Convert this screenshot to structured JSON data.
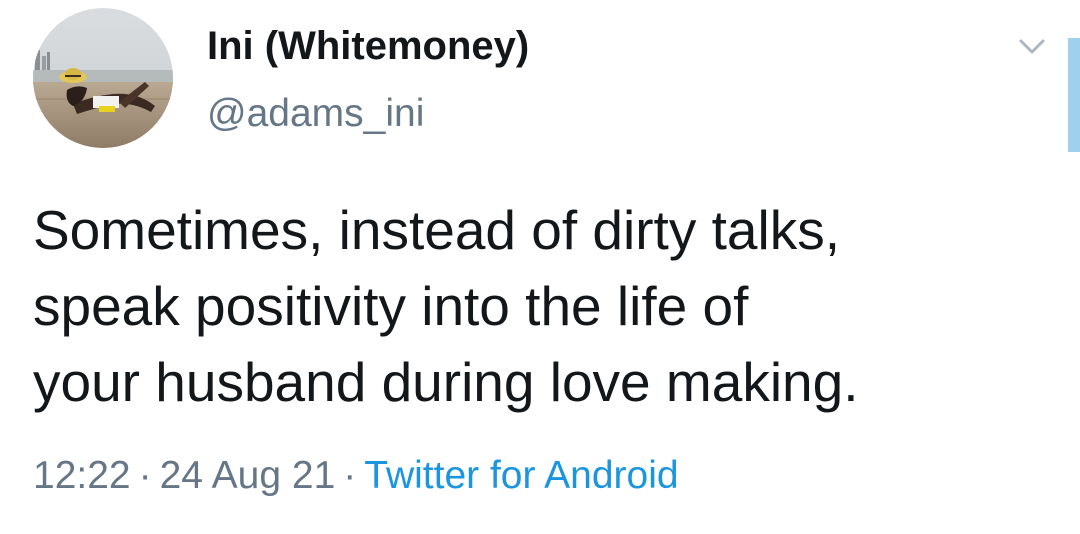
{
  "tweet": {
    "author": {
      "display_name": "Ini (Whitemoney)",
      "handle": "@adams_ini"
    },
    "text_lines": [
      "Sometimes, instead of dirty talks,",
      "speak positivity into the life of",
      "your husband during love making."
    ],
    "time": "12:22",
    "date": "24 Aug 21",
    "separator": "·",
    "source": "Twitter for Android"
  },
  "icons": {
    "menu": "chevron-down-icon"
  },
  "colors": {
    "text_primary": "#14171a",
    "text_secondary": "#657786",
    "link": "#1b95e0",
    "accent_bar": "#9fd0ee"
  }
}
